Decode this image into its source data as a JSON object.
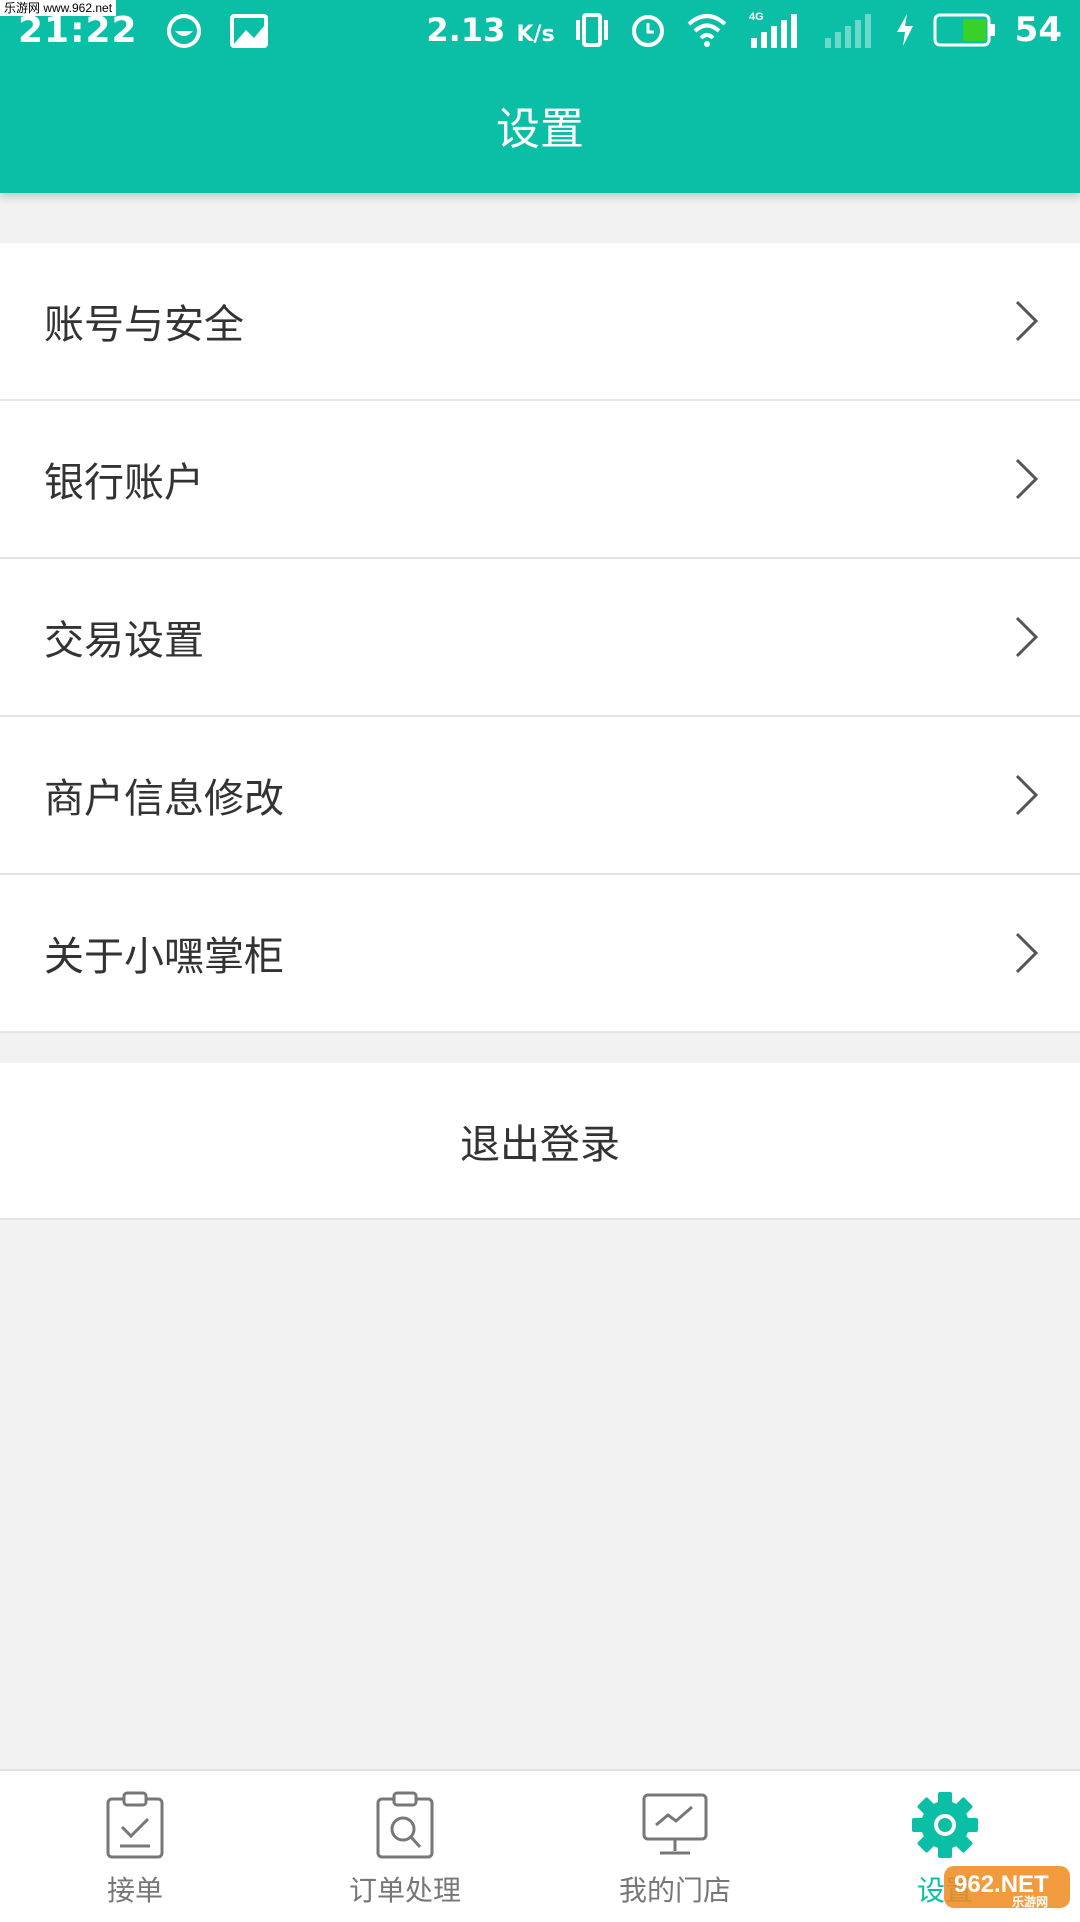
{
  "status_bar": {
    "time": "21:22",
    "speed": "2.13",
    "speed_unit": "K/s",
    "network_type": "4G",
    "battery": "54",
    "watermark": "乐游网 www.962.net"
  },
  "header": {
    "title": "设置"
  },
  "menu": {
    "items": [
      {
        "label": "账号与安全"
      },
      {
        "label": "银行账户"
      },
      {
        "label": "交易设置"
      },
      {
        "label": "商户信息修改"
      },
      {
        "label": "关于小嘿掌柜"
      }
    ]
  },
  "logout": {
    "label": "退出登录"
  },
  "tabbar": {
    "tabs": [
      {
        "label": "接单",
        "icon": "clipboard-check-icon"
      },
      {
        "label": "订单处理",
        "icon": "clipboard-search-icon"
      },
      {
        "label": "我的门店",
        "icon": "monitor-chart-icon"
      },
      {
        "label": "设置",
        "icon": "gear-icon"
      }
    ],
    "active_index": 3
  },
  "watermark_bottom": {
    "text": "962.NET",
    "sub": "乐游网"
  },
  "colors": {
    "accent": "#0bbfa7",
    "background": "#f2f2f2"
  }
}
